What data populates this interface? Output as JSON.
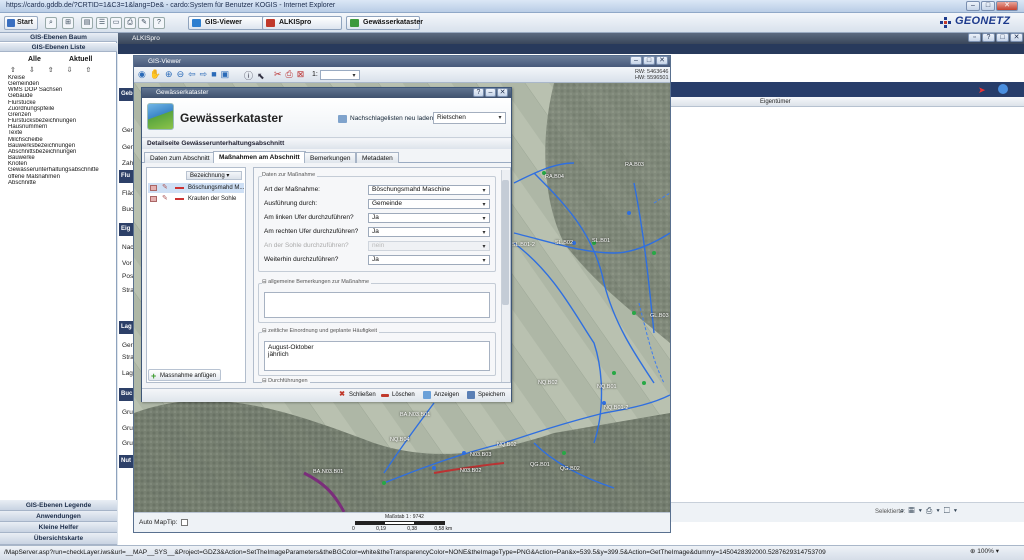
{
  "browser": {
    "title": "https://cardo.gddb.de/?CRTID=1&C3=1&lang=De& - cardo:System für Benutzer KOGIS - Internet Explorer",
    "status_url": "/MapServer.asp?run=checkLayer.iws&url=__MAP__SYS__&Project=GDZ3&Action=SetTheImageParameters&theBGColor=white&theTransparencyColor=NONE&theImageType=PNG&Action=Pan&x=539.5&y=399.5&Action=GetTheImage&dummy=1450428392000.5287629314753709",
    "zoom": "100%"
  },
  "toolbar": {
    "start_label": "Start",
    "tabs": [
      {
        "label": "GIS-Viewer",
        "color": "#2e7fd0"
      },
      {
        "label": "ALKISpro",
        "color": "#c0392b"
      },
      {
        "label": "Gewässerkataster",
        "color": "#3d9a3d"
      }
    ]
  },
  "brand": {
    "name": "GEONETZ",
    "color": "#1d3a8c"
  },
  "left_panel": {
    "tree_header": "GIS-Ebenen Baum",
    "list_header": "GIS-Ebenen Liste",
    "col_all": "Alle",
    "col_current": "Aktuell",
    "layers": [
      "Kreise",
      "Gemeinden",
      "WMS DOP Sachsen",
      "Gebäude",
      "Flurstücke",
      "Zuordnungspfeile",
      "Grenzen",
      "Flurstücksbezeichnungen",
      "Hausnummern",
      "Texte",
      "Milchscheibe",
      "Bauwerksbezeichnungen",
      "Abschnittsbezeichnungen",
      "Bauwerke",
      "Knoten",
      "Gewässerunterhaltungsabschnitte",
      "offene Maßnahmen",
      "Abschnitte"
    ],
    "bottom_heads": [
      "GIS-Ebenen Legende",
      "Anwendungen",
      "Kleine Helfer",
      "Übersichtskarte"
    ]
  },
  "alkis": {
    "title": "ALKISpro",
    "eigentuemer": "Eigentümer",
    "side_labels": [
      "Ger",
      "Gen",
      "Zah",
      "Fist",
      "Fläc",
      "Buc",
      "Nac",
      "Vor",
      "Pos",
      "Stra",
      "Ger",
      "Stra",
      "Lag",
      "Gru",
      "Gru",
      "Gru"
    ],
    "side_boxes": [
      "Geb",
      "Flu",
      "Eig",
      "Lag",
      "Buc",
      "Nut"
    ],
    "selektierte": "Selektierte:"
  },
  "gis_viewer": {
    "title": "GIS-Viewer",
    "rw": "RW: 5463646",
    "hw": "HW: 5596501",
    "scale_prefix": "1:",
    "auto_maptip": "Auto MapTip:",
    "scale_label": "Maßstab 1 : 9742",
    "scale_ticks": [
      "0",
      "0,19",
      "0,38",
      "0,58 km"
    ],
    "map_labels": [
      "RA.B04",
      "RA.B03",
      "SL.B02",
      "SL.B01-2",
      "SL.B01",
      "GL.B03",
      "NQ.B02",
      "NQ.B01",
      "NQ.B01-2",
      "NQ.B04",
      "NQ.B02",
      "BA.N03.B01",
      "QG.B01",
      "QG.B02",
      "N03.B02",
      "N03.B03",
      "BA.N03.B01"
    ]
  },
  "dialog": {
    "title": "Gewässerkataster",
    "app_name": "Gewässerkataster",
    "reload_label": "Nachschlagelisten neu laden",
    "place": "Rietschen",
    "detail_heading": "Detailseite Gewässerunterhaltungsabschnitt",
    "tabs": [
      "Daten zum Abschnitt",
      "Maßnahmen am Abschnitt",
      "Bemerkungen",
      "Metadaten"
    ],
    "active_tab": "Maßnahmen am Abschnitt",
    "list_header": "Bezeichnung",
    "measures": [
      "Böschungsmahd M...",
      "Krauten der Sohle"
    ],
    "add_button": "Massnahme anfügen",
    "form": {
      "section_title": "Daten zur Maßnahme",
      "fields": [
        {
          "label": "Art der Maßnahme:",
          "value": "Böschungsmahd Maschine",
          "disabled": false
        },
        {
          "label": "Ausführung durch:",
          "value": "Gemeinde",
          "disabled": false
        },
        {
          "label": "Am linken Ufer durchzuführen?",
          "value": "Ja",
          "disabled": false
        },
        {
          "label": "Am rechten Ufer durchzuführen?",
          "value": "Ja",
          "disabled": false
        },
        {
          "label": "An der Sohle durchzuführen?",
          "value": "nein",
          "disabled": true
        },
        {
          "label": "Weiterhin durchzuführen?",
          "value": "Ja",
          "disabled": false
        }
      ],
      "remarks_title": "allgemeine Bemerkungen zur Maßnahme",
      "remarks_value": "",
      "timing_title": "zeitliche Einordnung und geplante Häufigkeit",
      "timing_line1": "August-Oktober",
      "timing_line2": "jährlich",
      "executions_title": "Durchführungen"
    },
    "footer": {
      "close": "Schließen",
      "delete": "Löschen",
      "show": "Anzeigen",
      "save": "Speichern"
    }
  }
}
